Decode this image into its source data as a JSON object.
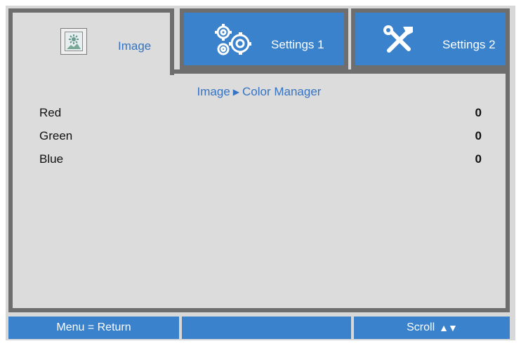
{
  "tabs": [
    {
      "label": "Image",
      "icon": "image-icon",
      "active": true
    },
    {
      "label": "Settings 1",
      "icon": "gears-icon",
      "active": false
    },
    {
      "label": "Settings 2",
      "icon": "tools-icon",
      "active": false
    }
  ],
  "breadcrumb": {
    "parent": "Image",
    "separator": "▶",
    "current": "Color Manager"
  },
  "items": [
    {
      "label": "Red",
      "value": "0"
    },
    {
      "label": "Green",
      "value": "0"
    },
    {
      "label": "Blue",
      "value": "0"
    }
  ],
  "footer": {
    "left": "Menu = Return",
    "middle": "",
    "right": "Scroll",
    "right_arrows": "▲▼"
  },
  "colors": {
    "accent_blue": "#3b82cc",
    "panel_gray": "#dcdcdc",
    "border_gray": "#6e6e6e",
    "active_text": "#3673c2"
  }
}
